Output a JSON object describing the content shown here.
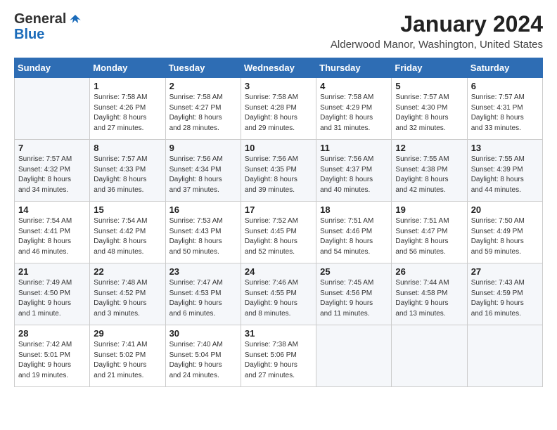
{
  "logo": {
    "general": "General",
    "blue": "Blue"
  },
  "title": "January 2024",
  "location": "Alderwood Manor, Washington, United States",
  "days_of_week": [
    "Sunday",
    "Monday",
    "Tuesday",
    "Wednesday",
    "Thursday",
    "Friday",
    "Saturday"
  ],
  "weeks": [
    [
      {
        "day": "",
        "info": ""
      },
      {
        "day": "1",
        "info": "Sunrise: 7:58 AM\nSunset: 4:26 PM\nDaylight: 8 hours\nand 27 minutes."
      },
      {
        "day": "2",
        "info": "Sunrise: 7:58 AM\nSunset: 4:27 PM\nDaylight: 8 hours\nand 28 minutes."
      },
      {
        "day": "3",
        "info": "Sunrise: 7:58 AM\nSunset: 4:28 PM\nDaylight: 8 hours\nand 29 minutes."
      },
      {
        "day": "4",
        "info": "Sunrise: 7:58 AM\nSunset: 4:29 PM\nDaylight: 8 hours\nand 31 minutes."
      },
      {
        "day": "5",
        "info": "Sunrise: 7:57 AM\nSunset: 4:30 PM\nDaylight: 8 hours\nand 32 minutes."
      },
      {
        "day": "6",
        "info": "Sunrise: 7:57 AM\nSunset: 4:31 PM\nDaylight: 8 hours\nand 33 minutes."
      }
    ],
    [
      {
        "day": "7",
        "info": "Sunrise: 7:57 AM\nSunset: 4:32 PM\nDaylight: 8 hours\nand 34 minutes."
      },
      {
        "day": "8",
        "info": "Sunrise: 7:57 AM\nSunset: 4:33 PM\nDaylight: 8 hours\nand 36 minutes."
      },
      {
        "day": "9",
        "info": "Sunrise: 7:56 AM\nSunset: 4:34 PM\nDaylight: 8 hours\nand 37 minutes."
      },
      {
        "day": "10",
        "info": "Sunrise: 7:56 AM\nSunset: 4:35 PM\nDaylight: 8 hours\nand 39 minutes."
      },
      {
        "day": "11",
        "info": "Sunrise: 7:56 AM\nSunset: 4:37 PM\nDaylight: 8 hours\nand 40 minutes."
      },
      {
        "day": "12",
        "info": "Sunrise: 7:55 AM\nSunset: 4:38 PM\nDaylight: 8 hours\nand 42 minutes."
      },
      {
        "day": "13",
        "info": "Sunrise: 7:55 AM\nSunset: 4:39 PM\nDaylight: 8 hours\nand 44 minutes."
      }
    ],
    [
      {
        "day": "14",
        "info": "Sunrise: 7:54 AM\nSunset: 4:41 PM\nDaylight: 8 hours\nand 46 minutes."
      },
      {
        "day": "15",
        "info": "Sunrise: 7:54 AM\nSunset: 4:42 PM\nDaylight: 8 hours\nand 48 minutes."
      },
      {
        "day": "16",
        "info": "Sunrise: 7:53 AM\nSunset: 4:43 PM\nDaylight: 8 hours\nand 50 minutes."
      },
      {
        "day": "17",
        "info": "Sunrise: 7:52 AM\nSunset: 4:45 PM\nDaylight: 8 hours\nand 52 minutes."
      },
      {
        "day": "18",
        "info": "Sunrise: 7:51 AM\nSunset: 4:46 PM\nDaylight: 8 hours\nand 54 minutes."
      },
      {
        "day": "19",
        "info": "Sunrise: 7:51 AM\nSunset: 4:47 PM\nDaylight: 8 hours\nand 56 minutes."
      },
      {
        "day": "20",
        "info": "Sunrise: 7:50 AM\nSunset: 4:49 PM\nDaylight: 8 hours\nand 59 minutes."
      }
    ],
    [
      {
        "day": "21",
        "info": "Sunrise: 7:49 AM\nSunset: 4:50 PM\nDaylight: 9 hours\nand 1 minute."
      },
      {
        "day": "22",
        "info": "Sunrise: 7:48 AM\nSunset: 4:52 PM\nDaylight: 9 hours\nand 3 minutes."
      },
      {
        "day": "23",
        "info": "Sunrise: 7:47 AM\nSunset: 4:53 PM\nDaylight: 9 hours\nand 6 minutes."
      },
      {
        "day": "24",
        "info": "Sunrise: 7:46 AM\nSunset: 4:55 PM\nDaylight: 9 hours\nand 8 minutes."
      },
      {
        "day": "25",
        "info": "Sunrise: 7:45 AM\nSunset: 4:56 PM\nDaylight: 9 hours\nand 11 minutes."
      },
      {
        "day": "26",
        "info": "Sunrise: 7:44 AM\nSunset: 4:58 PM\nDaylight: 9 hours\nand 13 minutes."
      },
      {
        "day": "27",
        "info": "Sunrise: 7:43 AM\nSunset: 4:59 PM\nDaylight: 9 hours\nand 16 minutes."
      }
    ],
    [
      {
        "day": "28",
        "info": "Sunrise: 7:42 AM\nSunset: 5:01 PM\nDaylight: 9 hours\nand 19 minutes."
      },
      {
        "day": "29",
        "info": "Sunrise: 7:41 AM\nSunset: 5:02 PM\nDaylight: 9 hours\nand 21 minutes."
      },
      {
        "day": "30",
        "info": "Sunrise: 7:40 AM\nSunset: 5:04 PM\nDaylight: 9 hours\nand 24 minutes."
      },
      {
        "day": "31",
        "info": "Sunrise: 7:38 AM\nSunset: 5:06 PM\nDaylight: 9 hours\nand 27 minutes."
      },
      {
        "day": "",
        "info": ""
      },
      {
        "day": "",
        "info": ""
      },
      {
        "day": "",
        "info": ""
      }
    ]
  ]
}
